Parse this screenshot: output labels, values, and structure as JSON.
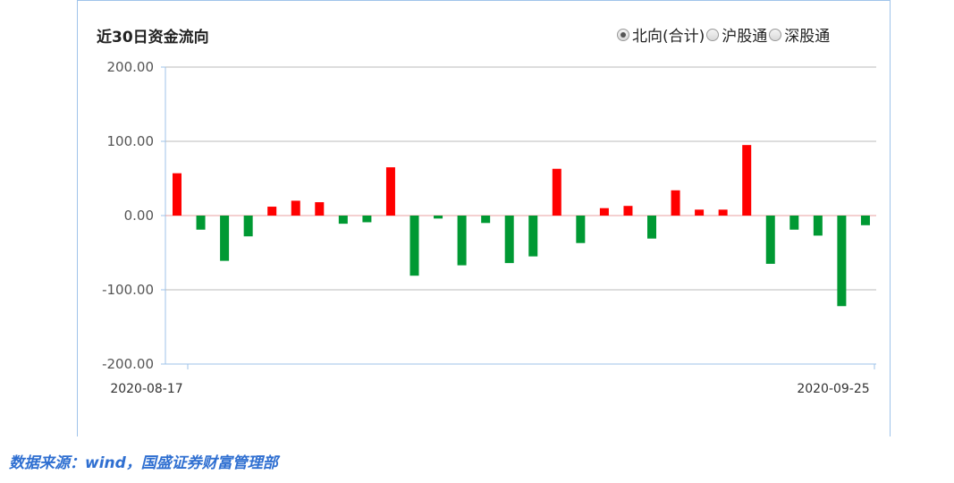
{
  "header": {
    "title": "近30日资金流向"
  },
  "radios": [
    {
      "label": "北向(合计)",
      "selected": true
    },
    {
      "label": "沪股通",
      "selected": false
    },
    {
      "label": "深股通",
      "selected": false
    }
  ],
  "footer": {
    "source": "数据来源：wind，国盛证券财富管理部"
  },
  "colors": {
    "positive": "#ff0000",
    "negative": "#009933",
    "grid": "#bbbbbb",
    "zero_line": "#e8a0a0"
  },
  "chart_data": {
    "type": "bar",
    "title": "近30日资金流向",
    "ylim": [
      -200,
      200
    ],
    "yticks": [
      "200.00",
      "100.00",
      "0.00",
      "-100.00",
      "-200.00"
    ],
    "ytick_values": [
      200,
      100,
      0,
      -100,
      -200
    ],
    "xtick_labels": {
      "first": "2020-08-17",
      "last": "2020-09-25"
    },
    "grid": true,
    "values": [
      57,
      -19,
      -61,
      -28,
      12,
      20,
      18,
      -11,
      -9,
      65,
      -81,
      -4,
      -67,
      -10,
      -64,
      -55,
      63,
      -37,
      10,
      13,
      -31,
      34,
      8,
      8,
      95,
      -65,
      -19,
      -27,
      -122,
      -13
    ]
  }
}
